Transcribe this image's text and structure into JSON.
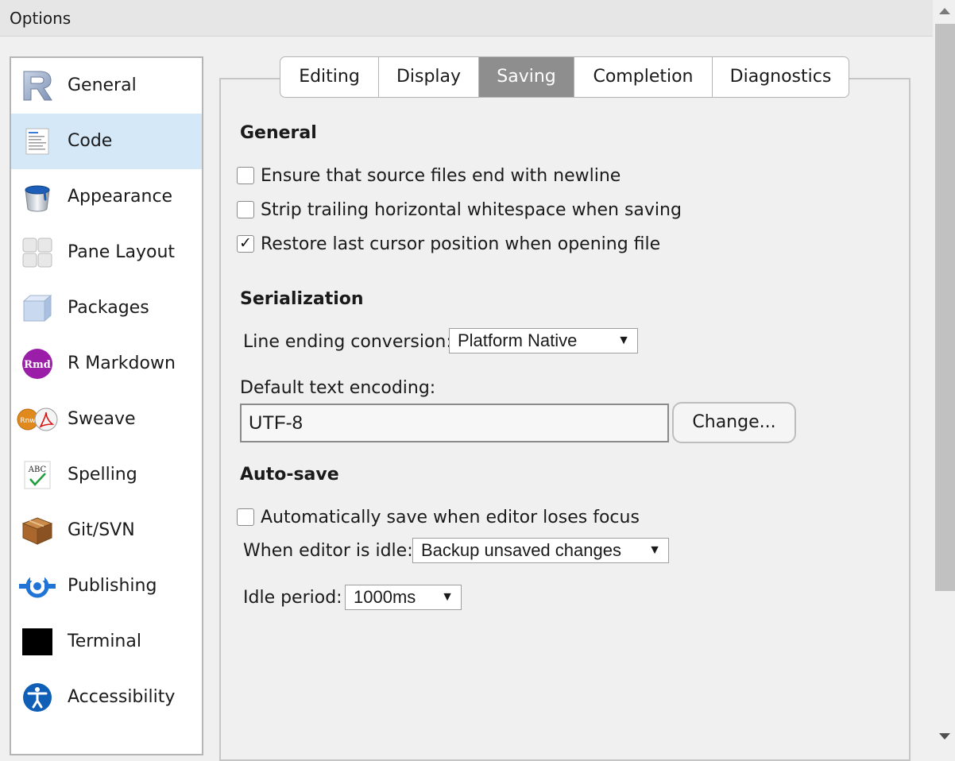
{
  "window": {
    "title": "Options"
  },
  "sidebar": {
    "selected": "Code",
    "items": [
      {
        "label": "General",
        "icon": "r-logo-icon"
      },
      {
        "label": "Code",
        "icon": "code-document-icon"
      },
      {
        "label": "Appearance",
        "icon": "paint-bucket-icon"
      },
      {
        "label": "Pane Layout",
        "icon": "pane-layout-icon"
      },
      {
        "label": "Packages",
        "icon": "package-box-icon"
      },
      {
        "label": "R Markdown",
        "icon": "rmd-icon"
      },
      {
        "label": "Sweave",
        "icon": "sweave-icon"
      },
      {
        "label": "Spelling",
        "icon": "spelling-icon"
      },
      {
        "label": "Git/SVN",
        "icon": "git-box-icon"
      },
      {
        "label": "Publishing",
        "icon": "publishing-icon"
      },
      {
        "label": "Terminal",
        "icon": "terminal-icon"
      },
      {
        "label": "Accessibility",
        "icon": "accessibility-icon"
      }
    ]
  },
  "tabs": [
    {
      "label": "Editing",
      "active": false
    },
    {
      "label": "Display",
      "active": false
    },
    {
      "label": "Saving",
      "active": true
    },
    {
      "label": "Completion",
      "active": false
    },
    {
      "label": "Diagnostics",
      "active": false
    }
  ],
  "general": {
    "heading": "General",
    "options": [
      {
        "label": "Ensure that source files end with newline",
        "checked": false
      },
      {
        "label": "Strip trailing horizontal whitespace when saving",
        "checked": false
      },
      {
        "label": "Restore last cursor position when opening file",
        "checked": true
      }
    ]
  },
  "serialization": {
    "heading": "Serialization",
    "line_ending_label": "Line ending conversion:",
    "line_ending_value": "Platform Native",
    "encoding_label": "Default text encoding:",
    "encoding_value": "UTF-8",
    "change_button": "Change..."
  },
  "autosave": {
    "heading": "Auto-save",
    "option": {
      "label": "Automatically save when editor loses focus",
      "checked": false
    },
    "idle_label": "When editor is idle:",
    "idle_value": "Backup unsaved changes",
    "period_label": "Idle period:",
    "period_value": "1000ms"
  },
  "glyphs": {
    "dropdown_arrow": "▼",
    "checkmark": "✓"
  },
  "colors": {
    "selected_sidebar": "#d5e8f7",
    "active_tab": "#8e8e8e",
    "rmd_purple": "#9b1ea8",
    "publishing_blue": "#1f74d6",
    "accessibility_blue": "#0e5fb5"
  }
}
